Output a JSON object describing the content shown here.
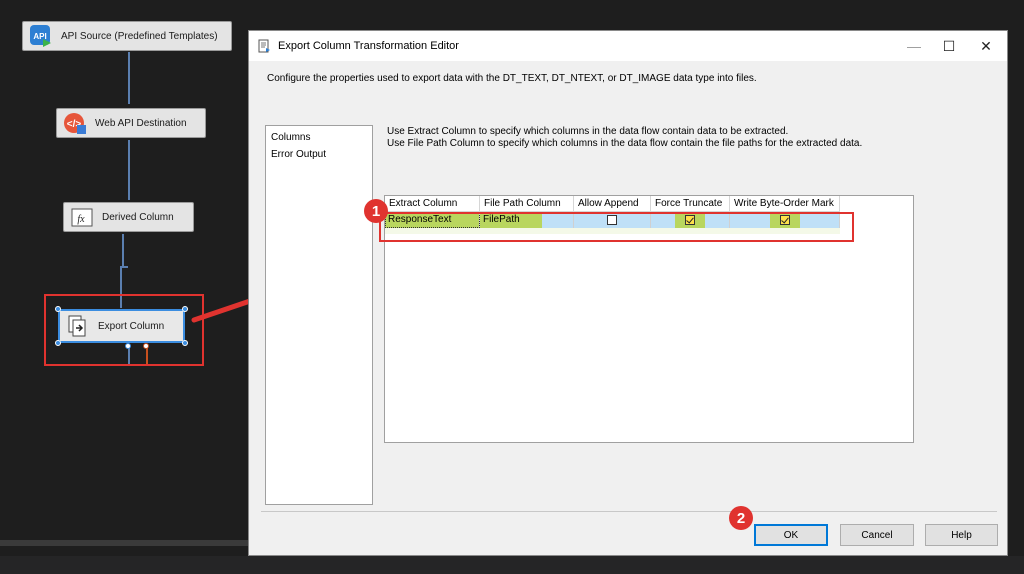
{
  "canvas": {
    "components": {
      "api_source": "API Source (Predefined Templates)",
      "web_api_destination": "Web API Destination",
      "derived_column": "Derived Column",
      "export_column": "Export Column"
    },
    "icon_labels": {
      "api": "API",
      "fx": "fx"
    }
  },
  "dialog": {
    "title": "Export Column Transformation Editor",
    "description": "Configure the properties used to export data with the DT_TEXT, DT_NTEXT, or DT_IMAGE data type into files.",
    "nav": [
      "Columns",
      "Error Output"
    ],
    "instructions": [
      "Use Extract Column to specify which columns in the data flow contain data to be extracted.",
      "Use File Path Column to specify which columns in the data flow contain the file paths for the extracted data."
    ],
    "grid": {
      "headers": [
        "Extract Column",
        "File Path Column",
        "Allow Append",
        "Force Truncate",
        "Write Byte-Order Mark"
      ],
      "row": {
        "extract_column": "ResponseText",
        "file_path_column": "FilePath",
        "allow_append": false,
        "force_truncate": true,
        "write_bom": true
      }
    },
    "buttons": {
      "ok": "OK",
      "cancel": "Cancel",
      "help": "Help"
    },
    "window_controls": {
      "minimize": "—",
      "maximize": "☐",
      "close": "✕"
    }
  },
  "annotations": {
    "badge1": "1",
    "badge2": "2"
  },
  "colors": {
    "highlight": "#e0332f",
    "selection": "#3b8de0",
    "grid_row": "#bfe0f7",
    "green_cell": "#b9d65e"
  }
}
